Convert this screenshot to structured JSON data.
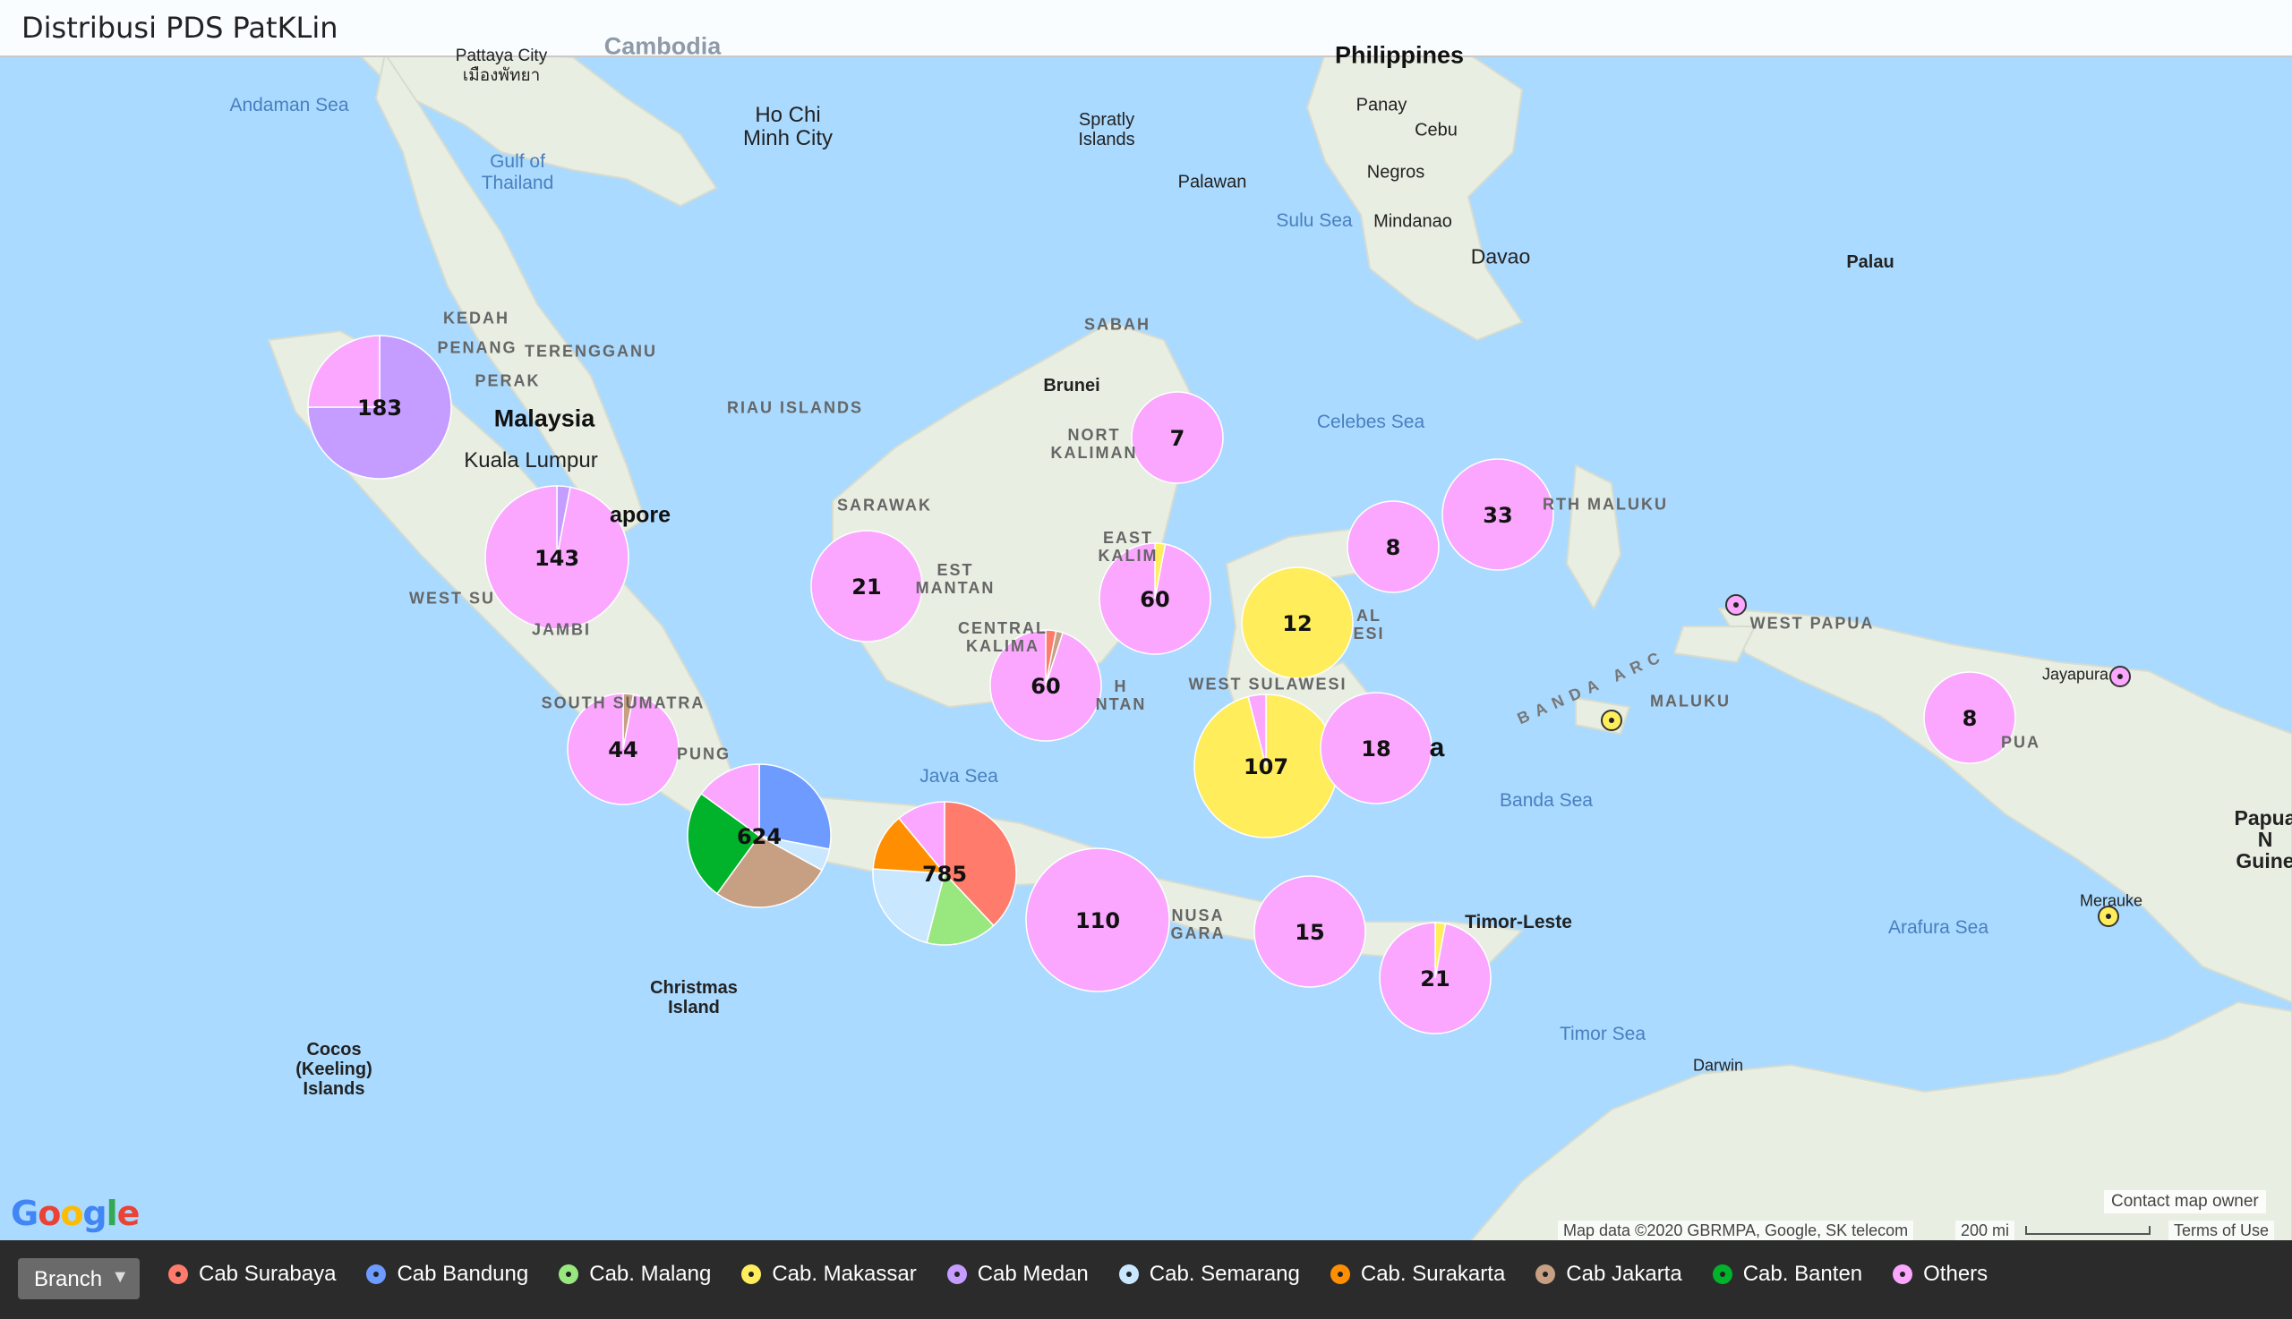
{
  "title": "Distribusi PDS PatKLin",
  "colors": {
    "sea": "#aadaff",
    "land": "#e8eee2",
    "cab_surabaya": "#ff7b6b",
    "cab_bandung": "#6d9bff",
    "cab_malang": "#99e77f",
    "cab_makassar": "#ffed5c",
    "cab_medan": "#c59cff",
    "cab_semarang": "#c9e7ff",
    "cab_surakarta": "#ff8f00",
    "cab_jakarta": "#c79f82",
    "cab_banten": "#00b32a",
    "others": "#fba7ff"
  },
  "map_labels": {
    "seas": {
      "andaman_sea": "Andaman Sea",
      "gulf_of_thailand": "Gulf of\nThailand",
      "sulu_sea": "Sulu Sea",
      "celebes_sea": "Celebes Sea",
      "java_sea": "Java Sea",
      "banda_sea": "Banda Sea",
      "arafura_sea": "Arafura Sea",
      "timor_sea": "Timor Sea"
    },
    "countries": {
      "cambodia": "Cambodia",
      "philippines": "Philippines",
      "malaysia": "Malaysia",
      "timor_leste": "Timor-Leste",
      "papua_new_guinea": "Papua N\nGuine",
      "brunei": "Brunei",
      "palau": "Palau"
    },
    "cities": {
      "pattaya": "Pattaya City\nเมืองพัทยา",
      "ho_chi_minh": "Ho Chi\nMinh City",
      "kuala_lumpur": "Kuala Lumpur",
      "singapore": "apore",
      "panay": "Panay",
      "cebu": "Cebu",
      "negros": "Negros",
      "mindanao": "Mindanao",
      "davao": "Davao",
      "palawan": "Palawan",
      "jayapura": "Jayapura",
      "merauke": "Merauke",
      "darwin": "Darwin"
    },
    "regions": {
      "kedah": "KEDAH",
      "penang": "PENANG",
      "terengganu": "TERENGGANU",
      "perak": "PERAK",
      "riau_islands": "RIAU ISLANDS",
      "sabah": "SABAH",
      "sarawak": "SARAWAK",
      "north_kalimantan": "NORT\nKALIMAN",
      "east_kalimantan": "EAST\nKALIM",
      "west_kalimantan": "EST\nMANTAN",
      "central_kalimantan": "CENTRAL\nKALIMA",
      "south_kalimantan": "H\nNTAN",
      "west_sumatra": "WEST SU",
      "jambi": "JAMBI",
      "south_sumatra": "SOUTH SUMATRA",
      "lampung": "PUNG",
      "west_sulawesi": "WEST SULAWESI",
      "central_sulawesi": "AL\nESI",
      "north_maluku": "RTH MALUKU",
      "west_papua": "WEST PAPUA",
      "maluku": "MALUKU",
      "banda_arc": "BANDA ARC",
      "papua": "PUA",
      "nusa_tenggara": "NUSA\nGARA",
      "sulawesi_tail": "a",
      "spratly": "Spratly\nIslands",
      "christmas_island": "Christmas\nIsland",
      "cocos_islands": "Cocos\n(Keeling)\nIslands"
    }
  },
  "legend": {
    "select_label": "Branch",
    "items": [
      {
        "label": "Cab Surabaya",
        "color": "#ff7b6b"
      },
      {
        "label": "Cab Bandung",
        "color": "#6d9bff"
      },
      {
        "label": "Cab. Malang",
        "color": "#99e77f"
      },
      {
        "label": "Cab. Makassar",
        "color": "#ffed5c"
      },
      {
        "label": "Cab Medan",
        "color": "#c59cff"
      },
      {
        "label": "Cab. Semarang",
        "color": "#c9e7ff"
      },
      {
        "label": "Cab. Surakarta",
        "color": "#ff8f00"
      },
      {
        "label": "Cab Jakarta",
        "color": "#c79f82"
      },
      {
        "label": "Cab. Banten",
        "color": "#00b32a"
      },
      {
        "label": "Others",
        "color": "#fba7ff"
      }
    ]
  },
  "attribution": {
    "google": "Google",
    "map_data": "Map data ©2020 GBRMPA, Google, SK telecom",
    "scale": "200 mi",
    "terms": "Terms of Use",
    "contact": "Contact map owner"
  },
  "chart_data": {
    "type": "pie",
    "clusters": [
      {
        "name": "cluster-north-sumatra",
        "label": "183",
        "total": 183,
        "slices": [
          {
            "branch": "Cab Medan",
            "value": 0.75
          },
          {
            "branch": "Others",
            "value": 0.25
          }
        ]
      },
      {
        "name": "cluster-riau",
        "label": "143",
        "total": 143,
        "slices": [
          {
            "branch": "Cab Medan",
            "value": 0.03
          },
          {
            "branch": "Others",
            "value": 0.97
          }
        ]
      },
      {
        "name": "cluster-south-sumatra",
        "label": "44",
        "total": 44,
        "slices": [
          {
            "branch": "Cab Jakarta",
            "value": 0.03
          },
          {
            "branch": "Others",
            "value": 0.97
          }
        ]
      },
      {
        "name": "cluster-west-java",
        "label": "624",
        "total": 624,
        "slices": [
          {
            "branch": "Cab Bandung",
            "value": 0.28
          },
          {
            "branch": "Cab. Semarang",
            "value": 0.05
          },
          {
            "branch": "Cab Jakarta",
            "value": 0.27
          },
          {
            "branch": "Cab. Banten",
            "value": 0.25
          },
          {
            "branch": "Others",
            "value": 0.15
          }
        ]
      },
      {
        "name": "cluster-east-java",
        "label": "785",
        "total": 785,
        "slices": [
          {
            "branch": "Cab Surabaya",
            "value": 0.38
          },
          {
            "branch": "Cab. Malang",
            "value": 0.16
          },
          {
            "branch": "Cab. Semarang",
            "value": 0.22
          },
          {
            "branch": "Cab. Surakarta",
            "value": 0.13
          },
          {
            "branch": "Others",
            "value": 0.11
          }
        ]
      },
      {
        "name": "cluster-bali",
        "label": "110",
        "total": 110,
        "slices": [
          {
            "branch": "Others",
            "value": 1.0
          }
        ]
      },
      {
        "name": "cluster-west-kalimantan",
        "label": "21",
        "total": 21,
        "slices": [
          {
            "branch": "Others",
            "value": 1.0
          }
        ]
      },
      {
        "name": "cluster-central-kalimantan",
        "label": "60",
        "total": 60,
        "slices": [
          {
            "branch": "Cab Surabaya",
            "value": 0.03
          },
          {
            "branch": "Cab Jakarta",
            "value": 0.02
          },
          {
            "branch": "Others",
            "value": 0.95
          }
        ]
      },
      {
        "name": "cluster-east-kalimantan",
        "label": "60",
        "total": 60,
        "slices": [
          {
            "branch": "Cab. Makassar",
            "value": 0.03
          },
          {
            "branch": "Others",
            "value": 0.97
          }
        ]
      },
      {
        "name": "cluster-north-kalimantan",
        "label": "7",
        "total": 7,
        "slices": [
          {
            "branch": "Others",
            "value": 1.0
          }
        ]
      },
      {
        "name": "cluster-central-sulawesi",
        "label": "12",
        "total": 12,
        "slices": [
          {
            "branch": "Cab. Makassar",
            "value": 1.0
          }
        ]
      },
      {
        "name": "cluster-south-sulawesi",
        "label": "107",
        "total": 107,
        "slices": [
          {
            "branch": "Cab. Makassar",
            "value": 0.96
          },
          {
            "branch": "Others",
            "value": 0.04
          }
        ]
      },
      {
        "name": "cluster-southeast-sulawesi",
        "label": "18",
        "total": 18,
        "slices": [
          {
            "branch": "Others",
            "value": 1.0
          }
        ]
      },
      {
        "name": "cluster-north-sulawesi",
        "label": "8",
        "total": 8,
        "slices": [
          {
            "branch": "Others",
            "value": 1.0
          }
        ]
      },
      {
        "name": "cluster-north-maluku",
        "label": "33",
        "total": 33,
        "slices": [
          {
            "branch": "Others",
            "value": 1.0
          }
        ]
      },
      {
        "name": "cluster-west-nusa-tenggara",
        "label": "15",
        "total": 15,
        "slices": [
          {
            "branch": "Others",
            "value": 1.0
          }
        ]
      },
      {
        "name": "cluster-east-nusa-tenggara",
        "label": "21",
        "total": 21,
        "slices": [
          {
            "branch": "Cab. Makassar",
            "value": 0.03
          },
          {
            "branch": "Others",
            "value": 0.97
          }
        ]
      },
      {
        "name": "cluster-papua",
        "label": "8",
        "total": 8,
        "slices": [
          {
            "branch": "Others",
            "value": 1.0
          }
        ]
      }
    ],
    "markers": [
      {
        "name": "marker-west-papua",
        "branch": "Others"
      },
      {
        "name": "marker-maluku",
        "branch": "Cab. Makassar"
      },
      {
        "name": "marker-jayapura",
        "branch": "Others"
      },
      {
        "name": "marker-merauke",
        "branch": "Cab. Makassar"
      }
    ]
  }
}
